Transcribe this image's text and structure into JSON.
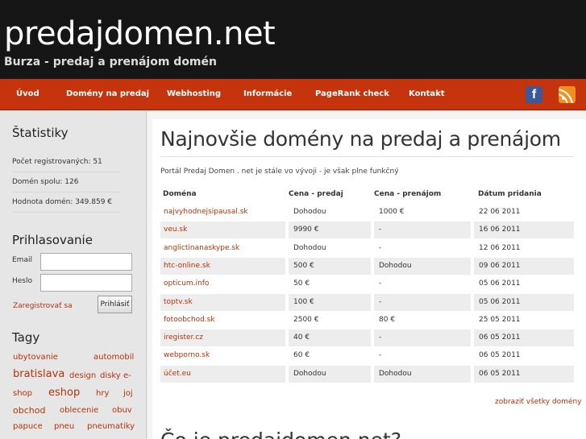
{
  "header": {
    "title": "predajdomen.net",
    "subtitle": "Burza - predaj a prenájom domén"
  },
  "nav": {
    "items": [
      "Úvod",
      "Domény na predaj",
      "Webhosting",
      "Informácie",
      "PageRank check",
      "Kontakt"
    ]
  },
  "social": {
    "facebook_icon": "facebook-icon",
    "facebook_glyph": "f",
    "rss_icon": "rss-icon",
    "facebook_color": "#3b5998",
    "rss_color": "#f0901e"
  },
  "sidebar": {
    "stats": {
      "heading": "Štatistiky",
      "items": [
        "Počet registrovaných: 51",
        "Domén spolu: 126",
        "Hodnota domén: 349.859 €"
      ]
    },
    "login": {
      "heading": "Prihlasovanie",
      "email_label": "Email",
      "password_label": "Heslo",
      "email_value": "",
      "password_value": "",
      "register_link": "Zaregistrovať sa",
      "submit_label": "Prihlásiť"
    },
    "tags": {
      "heading": "Tagy",
      "items": [
        "ubytovanie",
        "automobil",
        "bratislava",
        "design",
        "disky",
        "e-",
        "shop",
        "eshop",
        "hry",
        "joj",
        "obchod",
        "oblecenie",
        "obuv",
        "papuce",
        "pneu",
        "pneumatiky"
      ]
    }
  },
  "main": {
    "heading": "Najnovšie domény na predaj a prenájom",
    "intro": "Portál Predaj Domen . net je stále vo vývoji - je však plne funkčný",
    "table": {
      "headers": [
        "Doména",
        "Cena - predaj",
        "Cena - prenájom",
        "Dátum pridania"
      ],
      "rows": [
        [
          "najvyhodnejsipausal.sk",
          "Dohodou",
          "1000 €",
          "22 06 2011"
        ],
        [
          "veu.sk",
          "9990 €",
          "-",
          "16 06 2011"
        ],
        [
          "anglictinanaskype.sk",
          "Dohodou",
          "-",
          "12 06 2011"
        ],
        [
          "htc-online.sk",
          "500 €",
          "Dohodou",
          "09 06 2011"
        ],
        [
          "opticum.info",
          "50 €",
          "-",
          "05 06 2011"
        ],
        [
          "toptv.sk",
          "100 €",
          "-",
          "05 06 2011"
        ],
        [
          "fotoobchod.sk",
          "2500 €",
          "80 €",
          "25 05 2011"
        ],
        [
          "iregister.cz",
          "40 €",
          "-",
          "06 05 2011"
        ],
        [
          "webporno.sk",
          "60 €",
          "-",
          "06 05 2011"
        ],
        [
          "účet.eu",
          "Dohodou",
          "Dohodou",
          "06 05 2011"
        ]
      ]
    },
    "all_domains_link": "zobraziť všetky domény",
    "second_heading_partial": "Čo je predajdomen.net?"
  },
  "colors": {
    "nav_bg": "#c5340c",
    "header_bg": "#161616",
    "link": "#b53309"
  }
}
